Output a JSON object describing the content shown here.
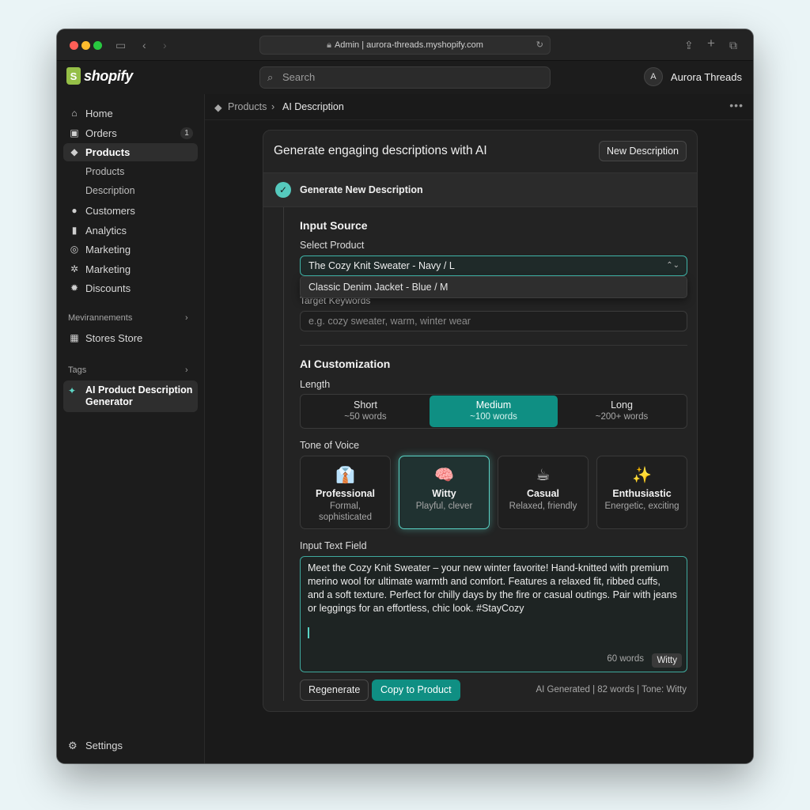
{
  "browser": {
    "url": "Admin | aurora-threads.myshopify.com",
    "lock_icon": "lock-icon",
    "reload_icon": "reload-icon"
  },
  "topbar": {
    "logo_text": "shopify",
    "search_placeholder": "Search",
    "account_initial": "A",
    "account_name": "Aurora Threads"
  },
  "sidebar": {
    "items": [
      {
        "label": "Home",
        "icon": "home-icon"
      },
      {
        "label": "Orders",
        "icon": "orders-icon",
        "badge": "1"
      },
      {
        "label": "Products",
        "icon": "tag-icon"
      },
      {
        "label": "Products"
      },
      {
        "label": "Description"
      },
      {
        "label": "Customers",
        "icon": "person-icon"
      },
      {
        "label": "Analytics",
        "icon": "bar-chart-icon"
      },
      {
        "label": "Marketing",
        "icon": "target-icon"
      },
      {
        "label": "Marketing",
        "icon": "gear-wheel-icon"
      },
      {
        "label": "Discounts",
        "icon": "discount-icon"
      }
    ],
    "section1": "Mevirannements",
    "stores": "Stores Store",
    "section2": "Tags",
    "app_item": "AI Product Description Generator",
    "settings": "Settings"
  },
  "breadcrumb": {
    "parent": "Products",
    "current": "AI Description"
  },
  "card": {
    "title": "Generate engaging descriptions with AI",
    "new_button": "New Description",
    "step_label": "Generate New Description",
    "input_source_title": "Input Source",
    "select_label": "Select Product",
    "selected_product": "The Cozy Knit Sweater - Navy / L",
    "dropdown_option": "Classic Denim Jacket - Blue / M",
    "keywords_label": "Target Keywords",
    "keywords_placeholder": "e.g. cozy sweater, warm, winter wear",
    "customization_title": "AI Customization",
    "length_label": "Length",
    "length_options": [
      {
        "title": "Short",
        "sub": "~50 words"
      },
      {
        "title": "Medium",
        "sub": "~100 words"
      },
      {
        "title": "Long",
        "sub": "~200+ words"
      }
    ],
    "selected_length": "Medium",
    "tone_label": "Tone of Voice",
    "tones": [
      {
        "emoji": "👔",
        "name": "Professional",
        "desc": "Formal, sophisticated"
      },
      {
        "emoji": "🧠",
        "name": "Witty",
        "desc": "Playful, clever"
      },
      {
        "emoji": "☕",
        "name": "Casual",
        "desc": "Relaxed, friendly"
      },
      {
        "emoji": "✨",
        "name": "Enthusiastic",
        "desc": "Energetic, exciting"
      }
    ],
    "selected_tone": "Witty",
    "text_field_label": "Input Text Field",
    "text_value": "Meet the Cozy Knit Sweater – your new winter favorite! Hand-knitted with premium merino wool for ultimate warmth and comfort. Features a relaxed fit, ribbed cuffs, and a soft texture. Perfect for chilly days by the fire or casual outings. Pair with jeans or leggings for an effortless, chic look. #StayCozy",
    "word_count": "60 words",
    "tone_chip": "Witty",
    "regenerate_button": "Regenerate",
    "copy_button": "Copy to Product",
    "meta": "AI Generated | 82 words | Tone: Witty"
  },
  "colors": {
    "accent": "#0f8f83",
    "accent_glow": "#59d3c5",
    "background": "#1a1a1a"
  }
}
